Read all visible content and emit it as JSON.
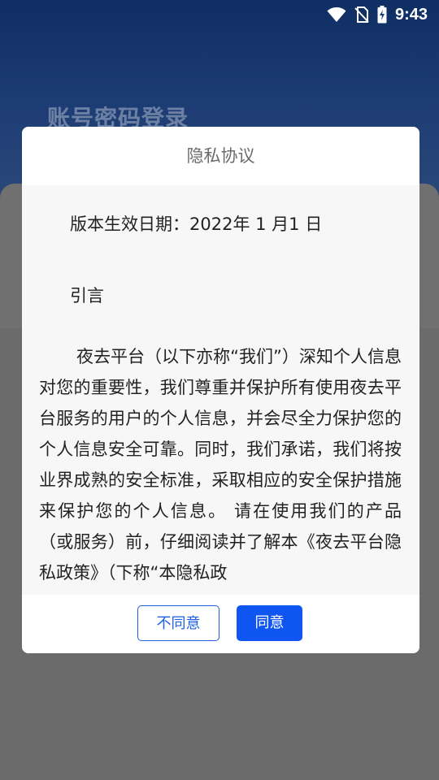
{
  "status_bar": {
    "time": "9:43",
    "icons": [
      "wifi-icon",
      "no-sim-icon",
      "battery-charging-icon"
    ]
  },
  "background": {
    "login_title": "账号密码登录"
  },
  "dialog": {
    "title": "隐私协议",
    "effective_date": "版本生效日期：2022年 1 月1 日",
    "intro_heading": "引言",
    "paragraph": "夜去平台（以下亦称“我们”）深知个人信息对您的重要性，我们尊重并保护所有使用夜去平台服务的用户的个人信息，并会尽全力保护您的个人信息安全可靠。同时，我们承诺，我们将按业界成熟的安全标准，采取相应的安全保护措施来保护您的个人信息。 请在使用我们的产品（或服务）前，仔细阅读并了解本《夜去平台隐私政策》（下称“本隐私政",
    "buttons": {
      "disagree": "不同意",
      "agree": "同意"
    }
  },
  "colors": {
    "primary": "#0f55f2",
    "header_bg": "#1b3b73",
    "overlay": "#6b6b6b"
  }
}
